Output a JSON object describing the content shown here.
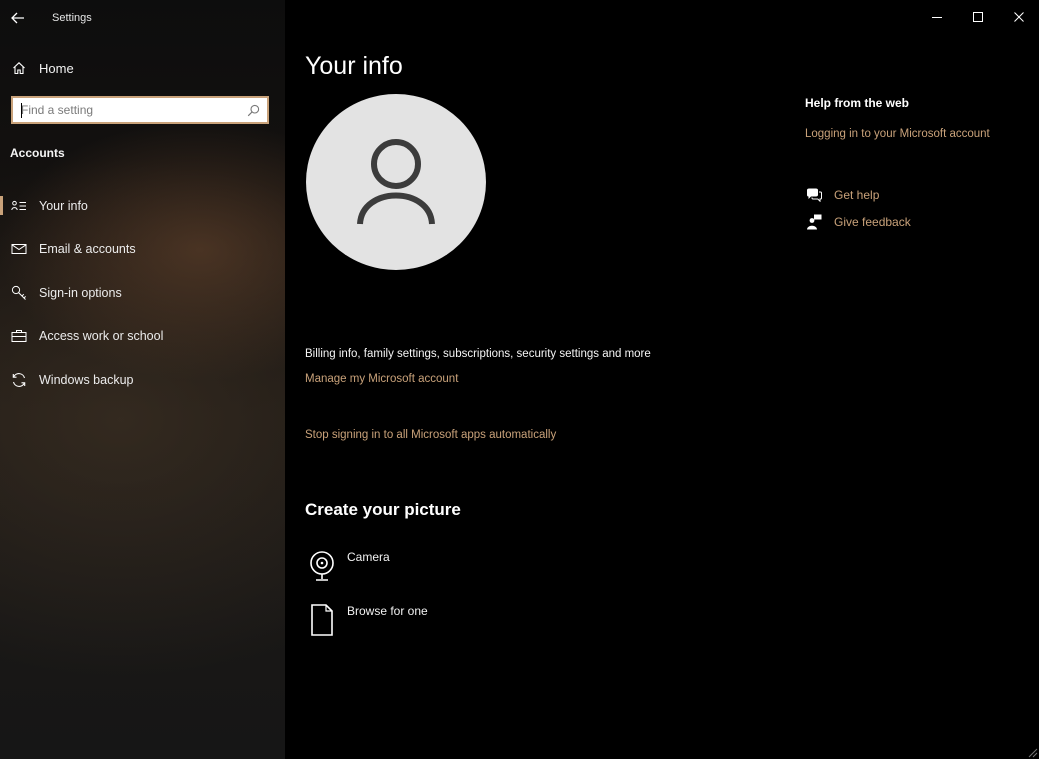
{
  "window": {
    "title": "Settings"
  },
  "sidebar": {
    "home_label": "Home",
    "search_placeholder": "Find a setting",
    "section_title": "Accounts",
    "items": [
      {
        "label": "Your info",
        "icon": "contact-card-icon",
        "selected": true
      },
      {
        "label": "Email & accounts",
        "icon": "mail-icon",
        "selected": false
      },
      {
        "label": "Sign-in options",
        "icon": "key-icon",
        "selected": false
      },
      {
        "label": "Access work or school",
        "icon": "briefcase-icon",
        "selected": false
      },
      {
        "label": "Windows backup",
        "icon": "sync-icon",
        "selected": false
      }
    ]
  },
  "main": {
    "title": "Your info",
    "billing_description": "Billing info, family settings, subscriptions, security settings and more",
    "manage_link": "Manage my Microsoft account",
    "stop_signin_link": "Stop signing in to all Microsoft apps automatically",
    "create_picture_title": "Create your picture",
    "picture_options": [
      {
        "label": "Camera",
        "icon": "camera-icon"
      },
      {
        "label": "Browse for one",
        "icon": "file-icon"
      }
    ]
  },
  "help": {
    "title": "Help from the web",
    "link": "Logging in to your Microsoft account",
    "get_help": "Get help",
    "give_feedback": "Give feedback"
  },
  "colors": {
    "accent": "#c9a27a",
    "background": "#000000",
    "avatar_bg": "#e3e3e3"
  }
}
